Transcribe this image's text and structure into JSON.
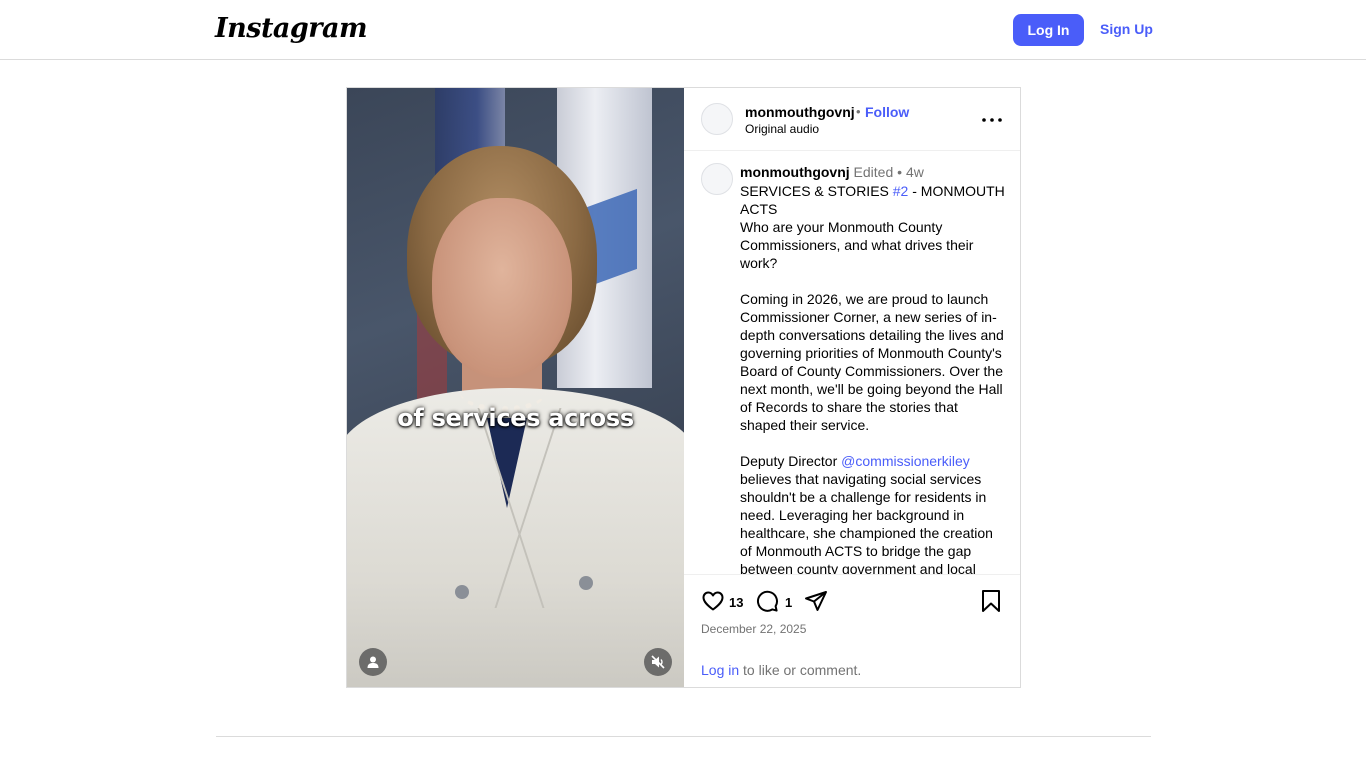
{
  "app": {
    "logo_text": "Instagram",
    "login_label": "Log In",
    "signup_label": "Sign Up"
  },
  "colors": {
    "accent": "#4a5df9",
    "border": "#dbdbdb",
    "muted_text": "#737373"
  },
  "media": {
    "caption_overlay": "of services across",
    "tag_icon": "user-tag-icon",
    "mute_icon": "speaker-muted-icon"
  },
  "post": {
    "username": "monmouthgovnj",
    "dot": "•",
    "follow_label": "Follow",
    "audio_label": "Original audio",
    "more_icon": "more-options-icon"
  },
  "caption": {
    "username": "monmouthgovnj",
    "edited": "Edited",
    "time_sep": "•",
    "time": "4w",
    "line1_pre": "SERVICES & STORIES ",
    "hashtag": "#2",
    "line1_post": " - MONMOUTH ACTS",
    "para1": "Who are your Monmouth County Commissioners, and what drives their work?",
    "para2": "Coming in 2026, we are proud to launch Commissioner Corner, a new series of in-depth conversations detailing the lives and governing priorities of Monmouth County's Board of County Commissioners. Over the next month, we'll be going beyond the Hall of Records to share the stories that shaped their service.",
    "para3_pre": "Deputy Director ",
    "mention": "@commissionerkiley",
    "para3_post": " believes that navigating social services shouldn't be a challenge for residents in need. Leveraging her background in healthcare, she championed the creation of Monmouth ACTS to bridge the gap between county government and local"
  },
  "actions": {
    "like_count": "13",
    "comment_count": "1",
    "date": "December 22, 2025",
    "login_link": "Log in",
    "login_suffix": " to like or comment."
  }
}
